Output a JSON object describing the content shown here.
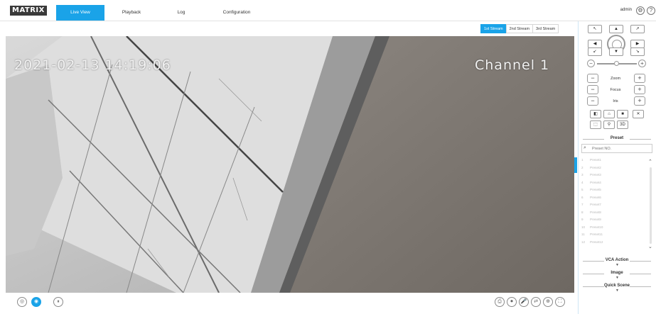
{
  "brand": {
    "logo_text": "MATRIX"
  },
  "nav": [
    {
      "label": "Live View",
      "active": true
    },
    {
      "label": "Playback",
      "active": false
    },
    {
      "label": "Log",
      "active": false
    },
    {
      "label": "Configuration",
      "active": false
    }
  ],
  "header": {
    "user": "admin",
    "settings_icon": "gear-icon",
    "help_label": "?"
  },
  "streams": [
    {
      "label": "1st Stream",
      "active": true
    },
    {
      "label": "2nd Stream",
      "active": false
    },
    {
      "label": "3rd Stream",
      "active": false
    }
  ],
  "video": {
    "timestamp": "2021-02-13 14:19:06",
    "channel": "Channel 1"
  },
  "ptz": {
    "directions": [
      "↖",
      "▲",
      "↗",
      "◀",
      "▶",
      "↙",
      "▼",
      "↘"
    ],
    "lens": {
      "zoom": "Zoom",
      "focus": "Focus",
      "iris": "Iris",
      "minus": "−",
      "plus": "+"
    },
    "zoom_minus": "−",
    "zoom_plus": "+",
    "tools": [
      "◧",
      "⌂",
      "■",
      "✕",
      "⬚",
      "⚲",
      "3D"
    ]
  },
  "preset": {
    "title": "Preset",
    "search_placeholder": "Preset NO.",
    "items": [
      {
        "num": "1",
        "name": "Preset1"
      },
      {
        "num": "2",
        "name": "Preset2"
      },
      {
        "num": "3",
        "name": "Preset3"
      },
      {
        "num": "4",
        "name": "Preset4"
      },
      {
        "num": "5",
        "name": "Preset5"
      },
      {
        "num": "6",
        "name": "Preset6"
      },
      {
        "num": "7",
        "name": "Preset7"
      },
      {
        "num": "8",
        "name": "Preset8"
      },
      {
        "num": "9",
        "name": "Preset9"
      },
      {
        "num": "10",
        "name": "Preset10"
      },
      {
        "num": "11",
        "name": "Preset11"
      },
      {
        "num": "12",
        "name": "Preset12"
      }
    ]
  },
  "sections": {
    "vca": "VCA Action",
    "image": "Image",
    "quick_scene": "Quick Scene"
  },
  "bottom_left": [
    "◎",
    "◉",
    "⏸"
  ],
  "bottom_right": [
    "⎙",
    "⏺",
    "🎤",
    "⇄",
    "⊕",
    "⛶"
  ],
  "colors": {
    "accent": "#1aa3e8"
  }
}
